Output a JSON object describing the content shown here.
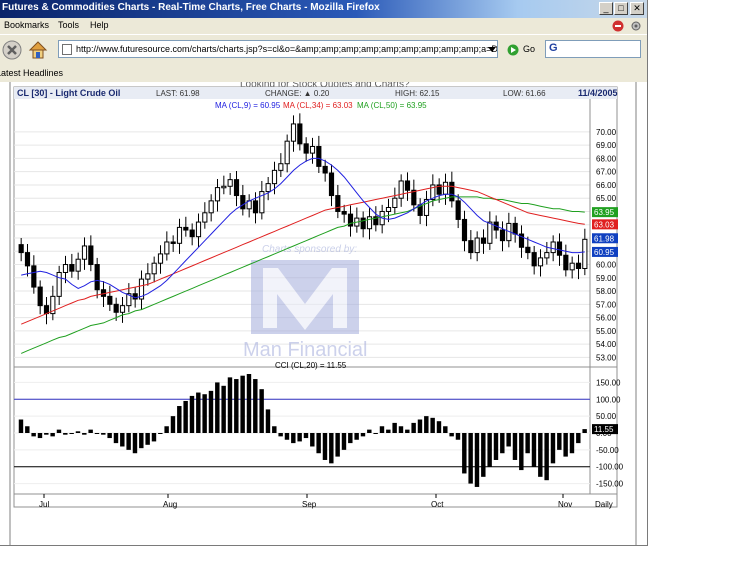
{
  "window": {
    "title": "Futures & Commodities Charts - Real-Time Charts, Free Charts - Mozilla Firefox",
    "minimize_icon": "minimize-icon",
    "maximize_icon": "maximize-icon",
    "close_icon": "close-icon"
  },
  "menu": {
    "items": [
      "Bookmarks",
      "Tools",
      "Help"
    ]
  },
  "toolbar": {
    "url": "http://www.futuresource.com/charts/charts.jsp?s=cl&o=&amp;amp;amp;amp;amp;amp;amp;amp;amp;a=D&z",
    "go_label": "Go",
    "search_value": "G"
  },
  "bookmarks_bar": {
    "headlines": "Latest Headlines"
  },
  "chart_header": {
    "symbol": "CL [30] - Light Crude Oil",
    "last": "LAST: 61.98",
    "change": "CHANGE: ▲ 0.20",
    "high": "HIGH: 62.15",
    "low": "LOW: 61.66",
    "date": "11/4/2005",
    "ma9": "MA (CL,9) = 60.95",
    "ma34": "MA (CL,34) = 63.03",
    "ma50": "MA (CL,50) = 63.95",
    "top_cutoff": "Looking for Stock Quotes and Charts?"
  },
  "sponsor": {
    "line": "Charts sponsored by:",
    "name": "Man Financial",
    "logo": "M"
  },
  "colors": {
    "ma9": "#2020e0",
    "ma34": "#e02020",
    "ma50": "#20a020",
    "last": "#1040c0",
    "cci_line": "#3030c0"
  },
  "chart_data": [
    {
      "type": "candlestick",
      "title": "CL [30] - Light Crude Oil",
      "ylim": [
        52.5,
        71.5
      ],
      "yticks": [
        "70.00",
        "69.00",
        "68.00",
        "67.00",
        "66.00",
        "65.00",
        "64.00",
        "63.00",
        "62.00",
        "61.00",
        "60.00",
        "59.00",
        "58.00",
        "57.00",
        "56.00",
        "55.00",
        "54.00",
        "53.00"
      ],
      "xlabels": [
        "Jul",
        "Aug",
        "Sep",
        "Oct",
        "Nov",
        "Daily"
      ],
      "close": [
        60.9,
        59.9,
        58.3,
        56.9,
        56.3,
        57.6,
        59.4,
        60.0,
        59.5,
        60.4,
        61.4,
        60.0,
        58.1,
        57.6,
        57.0,
        56.4,
        56.9,
        57.8,
        57.4,
        58.9,
        59.3,
        60.1,
        60.8,
        61.7,
        61.6,
        62.8,
        62.6,
        62.1,
        63.2,
        63.9,
        64.8,
        65.8,
        65.9,
        66.4,
        65.2,
        64.2,
        64.8,
        63.9,
        65.5,
        66.1,
        67.1,
        67.6,
        69.3,
        70.6,
        69.1,
        68.4,
        68.9,
        67.4,
        66.9,
        65.2,
        64.0,
        63.8,
        62.9,
        63.5,
        62.7,
        63.6,
        63.0,
        64.0,
        64.3,
        65.0,
        66.3,
        65.6,
        64.5,
        63.7,
        64.9,
        66.0,
        65.3,
        66.2,
        64.8,
        63.4,
        61.8,
        60.9,
        62.0,
        61.6,
        63.2,
        62.6,
        61.8,
        63.1,
        62.3,
        61.3,
        60.9,
        59.9,
        60.5,
        60.9,
        61.7,
        60.7,
        59.6,
        60.1,
        59.7,
        61.9
      ],
      "ma9": [
        59.2,
        59.3,
        59.4,
        59.5,
        59.4,
        59.2,
        59.0,
        58.9,
        58.5,
        58.2,
        58.4,
        58.7,
        58.8,
        58.7,
        58.5,
        58.2,
        57.9,
        57.7,
        57.5,
        57.6,
        57.8,
        58.1,
        58.4,
        58.8,
        59.3,
        59.8,
        60.3,
        60.8,
        61.3,
        61.8,
        62.3,
        62.8,
        63.3,
        63.8,
        64.2,
        64.5,
        64.8,
        65.0,
        65.2,
        65.4,
        65.7,
        66.1,
        66.6,
        67.1,
        67.5,
        67.8,
        68.0,
        68.0,
        67.8,
        67.5,
        67.1,
        66.6,
        66.0,
        65.4,
        64.8,
        64.3,
        63.8,
        63.5,
        63.4,
        63.5,
        63.7,
        63.9,
        64.2,
        64.5,
        64.8,
        65.0,
        65.2,
        65.3,
        65.3,
        65.1,
        64.7,
        64.2,
        63.7,
        63.3,
        63.1,
        62.9,
        62.7,
        62.5,
        62.3,
        62.1,
        61.9,
        61.7,
        61.5,
        61.3,
        61.2,
        61.1,
        61.0,
        60.9,
        60.9,
        60.95
      ],
      "ma34": [
        55.5,
        55.7,
        55.9,
        56.1,
        56.3,
        56.5,
        56.7,
        56.9,
        57.1,
        57.3,
        57.4,
        57.6,
        57.7,
        57.8,
        57.9,
        58.0,
        58.1,
        58.2,
        58.3,
        58.4,
        58.5,
        58.7,
        58.9,
        59.1,
        59.3,
        59.5,
        59.7,
        59.9,
        60.1,
        60.3,
        60.5,
        60.7,
        60.9,
        61.1,
        61.3,
        61.5,
        61.7,
        61.9,
        62.1,
        62.3,
        62.5,
        62.7,
        62.9,
        63.1,
        63.3,
        63.5,
        63.7,
        63.9,
        64.1,
        64.2,
        64.3,
        64.4,
        64.5,
        64.6,
        64.7,
        64.8,
        64.9,
        65.0,
        65.1,
        65.2,
        65.3,
        65.4,
        65.5,
        65.6,
        65.7,
        65.8,
        65.9,
        65.9,
        65.9,
        65.8,
        65.7,
        65.6,
        65.5,
        65.3,
        65.1,
        64.9,
        64.7,
        64.5,
        64.3,
        64.1,
        63.9,
        63.8,
        63.7,
        63.6,
        63.5,
        63.4,
        63.3,
        63.2,
        63.1,
        63.03
      ],
      "ma50": [
        53.3,
        53.5,
        53.7,
        53.9,
        54.1,
        54.3,
        54.5,
        54.6,
        54.8,
        55.0,
        55.2,
        55.4,
        55.5,
        55.6,
        55.8,
        56.0,
        56.2,
        56.3,
        56.5,
        56.6,
        56.8,
        57.0,
        57.2,
        57.4,
        57.6,
        57.8,
        58.0,
        58.2,
        58.4,
        58.6,
        58.8,
        59.0,
        59.2,
        59.4,
        59.6,
        59.8,
        60.0,
        60.2,
        60.4,
        60.6,
        60.8,
        61.0,
        61.2,
        61.4,
        61.6,
        61.8,
        62.0,
        62.2,
        62.4,
        62.6,
        62.8,
        62.9,
        63.1,
        63.2,
        63.3,
        63.4,
        63.5,
        63.6,
        63.7,
        63.8,
        63.9,
        64.0,
        64.2,
        64.4,
        64.6,
        64.8,
        64.9,
        65.0,
        65.1,
        65.1,
        65.1,
        65.1,
        65.1,
        65.0,
        65.0,
        64.9,
        64.9,
        64.8,
        64.7,
        64.6,
        64.6,
        64.5,
        64.4,
        64.3,
        64.2,
        64.2,
        64.1,
        64.0,
        64.0,
        63.95
      ],
      "last_label": "61.98",
      "ma_labels": [
        "63.95",
        "63.03",
        "60.95"
      ]
    },
    {
      "type": "bar",
      "title": "CCI (CL,20) = 11.55",
      "ylim": [
        -175,
        175
      ],
      "yticks": [
        "150.00",
        "100.00",
        "50.00",
        "0.00",
        "-50.00",
        "-100.00",
        "-150.00"
      ],
      "reference_lines": [
        100,
        -100
      ],
      "values": [
        40,
        20,
        -10,
        -15,
        -5,
        -10,
        10,
        -5,
        0,
        5,
        -5,
        10,
        0,
        -5,
        -15,
        -30,
        -40,
        -50,
        -60,
        -45,
        -35,
        -25,
        0,
        20,
        50,
        80,
        95,
        110,
        120,
        115,
        125,
        150,
        140,
        165,
        160,
        170,
        175,
        160,
        130,
        70,
        20,
        -10,
        -20,
        -30,
        -25,
        -15,
        -40,
        -60,
        -80,
        -90,
        -70,
        -50,
        -30,
        -20,
        -10,
        10,
        0,
        20,
        10,
        30,
        20,
        10,
        30,
        40,
        50,
        45,
        35,
        20,
        -10,
        -20,
        -120,
        -150,
        -160,
        -130,
        -100,
        -80,
        -60,
        -40,
        -80,
        -110,
        -60,
        -100,
        -130,
        -140,
        -90,
        -50,
        -70,
        -60,
        -30,
        11.55
      ],
      "current_label": "11.55"
    }
  ]
}
